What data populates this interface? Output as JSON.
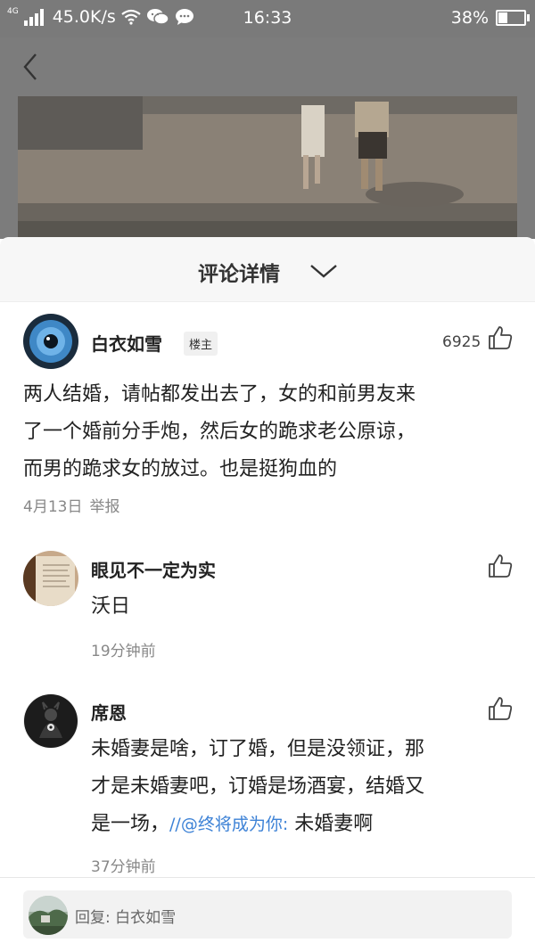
{
  "status_bar": {
    "network": "4G",
    "speed": "45.0K/s",
    "time": "16:33",
    "battery": "38%",
    "battery_level": 0.38
  },
  "sheet": {
    "title": "评论详情"
  },
  "main_comment": {
    "username": "白衣如雪",
    "badge": "楼主",
    "likes": "6925",
    "lines": [
      "两人结婚，请帖都发出去了，女的和前男友来",
      "了一个婚前分手炮，然后女的跪求老公原谅，",
      "而男的跪求女的放过。也是挺狗血的"
    ],
    "date": "4月13日",
    "report": "举报"
  },
  "replies": [
    {
      "username": "眼见不一定为实",
      "text": "沃日",
      "time": "19分钟前"
    },
    {
      "username": "席恩",
      "line1": "未婚妻是啥，订了婚，但是没领证，那",
      "line2": "才是未婚妻吧，订婚是场酒宴，结婚又",
      "line3_start": "是一场，",
      "mention": "//@终将成为你:",
      "line3_end": " 未婚妻啊",
      "time": "37分钟前"
    }
  ],
  "reply_bar": {
    "placeholder": "回复: 白衣如雪"
  },
  "colors": {
    "overlay": "#7c7c7c",
    "mention": "#3d82d6",
    "meta": "#888888"
  }
}
